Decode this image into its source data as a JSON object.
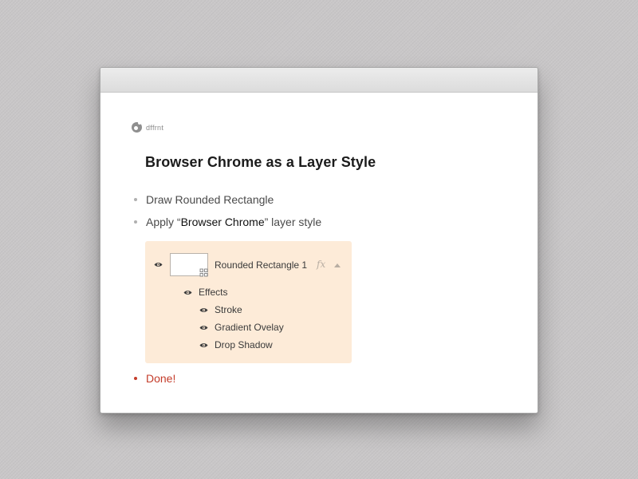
{
  "logo": {
    "text": "dffrnt"
  },
  "title": "Browser Chrome as a Layer Style",
  "steps": [
    {
      "prefix": "Draw Rounded Rectangle"
    },
    {
      "prefix": "Apply “",
      "highlight": "Browser Chrome",
      "suffix": "” layer style"
    },
    {
      "prefix": "Done!"
    }
  ],
  "layers_panel": {
    "layer_name": "Rounded Rectangle 1",
    "fx_label": "fx",
    "effects_label": "Effects",
    "effects": [
      "Stroke",
      "Gradient Ovelay",
      "Drop Shadow"
    ]
  },
  "colors": {
    "panel_bg": "#fdebd8",
    "done_accent": "#c43c2a",
    "titlebar": "#e4e4e4"
  }
}
